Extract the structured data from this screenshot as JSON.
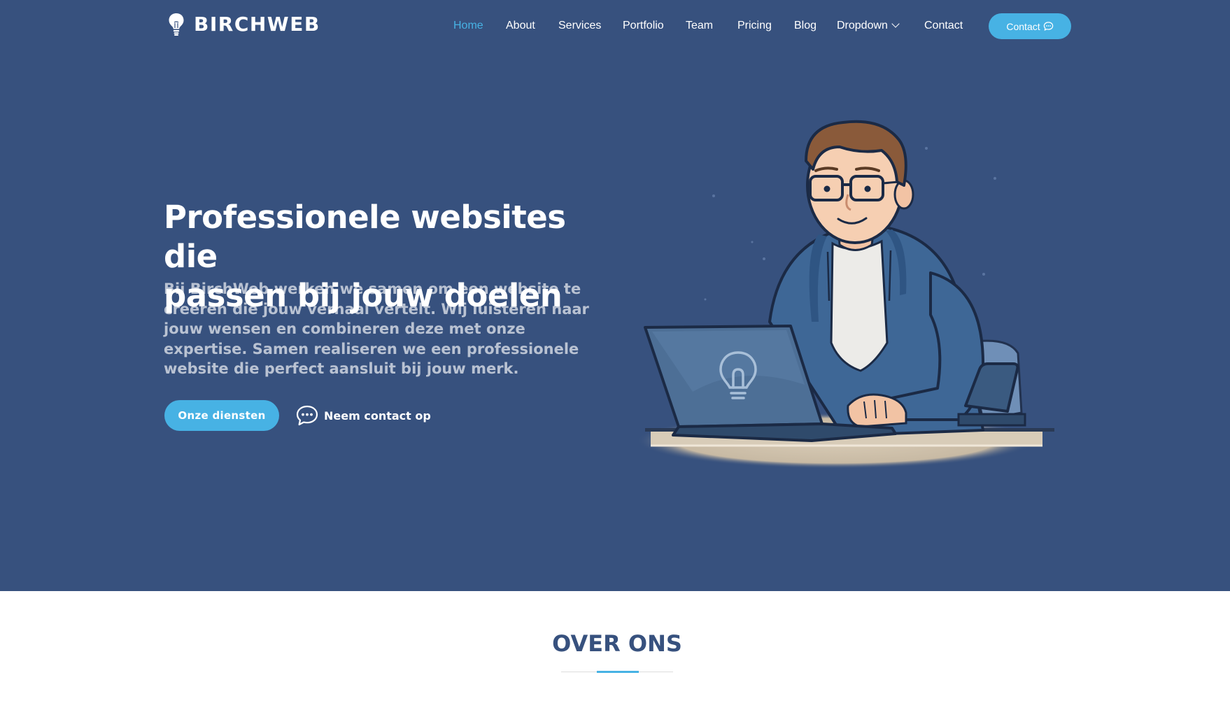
{
  "brand": {
    "name": "BIRCHWEB"
  },
  "nav": {
    "items": [
      {
        "label": "Home",
        "active": true
      },
      {
        "label": "About"
      },
      {
        "label": "Services"
      },
      {
        "label": "Portfolio"
      },
      {
        "label": "Team"
      },
      {
        "label": "Pricing"
      },
      {
        "label": "Blog"
      },
      {
        "label": "Dropdown"
      },
      {
        "label": "Contact"
      }
    ],
    "cta_label": "Contact"
  },
  "hero": {
    "title_line1": "Professionele websites die",
    "title_line2": "passen bij jouw doelen",
    "subtitle": "Bij BirchWeb werken we samen om een website te creëren die jouw verhaal vertelt. Wij luisteren naar jouw wensen en combineren deze met onze expertise. Samen realiseren we een professionele website die perfect aansluit bij jouw merk.",
    "primary_button": "Onze diensten",
    "secondary_button": "Neem contact op"
  },
  "about": {
    "title": "OVER ONS"
  },
  "colors": {
    "background": "#37517e",
    "accent": "#47b2e4",
    "text": "#ffffff"
  },
  "icons": [
    "lightbulb-icon",
    "chevron-down-icon",
    "chat-icon"
  ]
}
